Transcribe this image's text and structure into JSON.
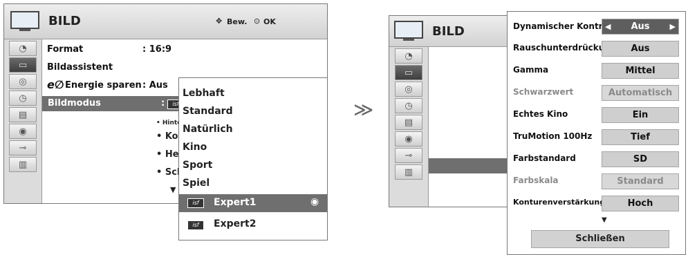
{
  "left_panel": {
    "title": "BILD",
    "nav_hint": "Bew.",
    "ok_hint": "OK",
    "rows": [
      {
        "label": "Format",
        "value": ": 16:9"
      },
      {
        "label": "Bildassistent",
        "value": ""
      },
      {
        "label": "Energie sparen",
        "value": ": Aus"
      },
      {
        "label": "Bildmodus",
        "value": ":"
      }
    ],
    "sub_items": [
      "• Hintergr",
      "• Kont",
      "• Helli",
      "• Schä"
    ],
    "eco_symbol": "e∅"
  },
  "mode_popup": {
    "items": [
      "Lebhaft",
      "Standard",
      "Natürlich",
      "Kino",
      "Sport",
      "Spiel"
    ],
    "expert_items": [
      "Expert1",
      "Expert2"
    ],
    "isf_label": "isf"
  },
  "arrow": "≫",
  "right_small": {
    "title": "BILD"
  },
  "right_panel": {
    "settings": [
      {
        "label": "Dynamischer Kontrast",
        "value": "Aus",
        "state": "selected"
      },
      {
        "label": "Rauschunterdrückung",
        "value": "Aus",
        "state": "normal"
      },
      {
        "label": "Gamma",
        "value": "Mittel",
        "state": "normal"
      },
      {
        "label": "Schwarzwert",
        "value": "Automatisch",
        "state": "dim"
      },
      {
        "label": "Echtes Kino",
        "value": "Ein",
        "state": "normal"
      },
      {
        "label": "TruMotion 100Hz",
        "value": "Tief",
        "state": "normal"
      },
      {
        "label": "Farbstandard",
        "value": "SD",
        "state": "normal"
      },
      {
        "label": "Farbskala",
        "value": "Standard",
        "state": "dim"
      },
      {
        "label": "Konturenverstärkung",
        "value": "Hoch",
        "state": "normal"
      }
    ],
    "close_label": "Schließen"
  },
  "colors": {
    "selected": "#6f6f6f",
    "value_bg": "#cfcfcf",
    "dim_text": "#8a8a8a"
  }
}
